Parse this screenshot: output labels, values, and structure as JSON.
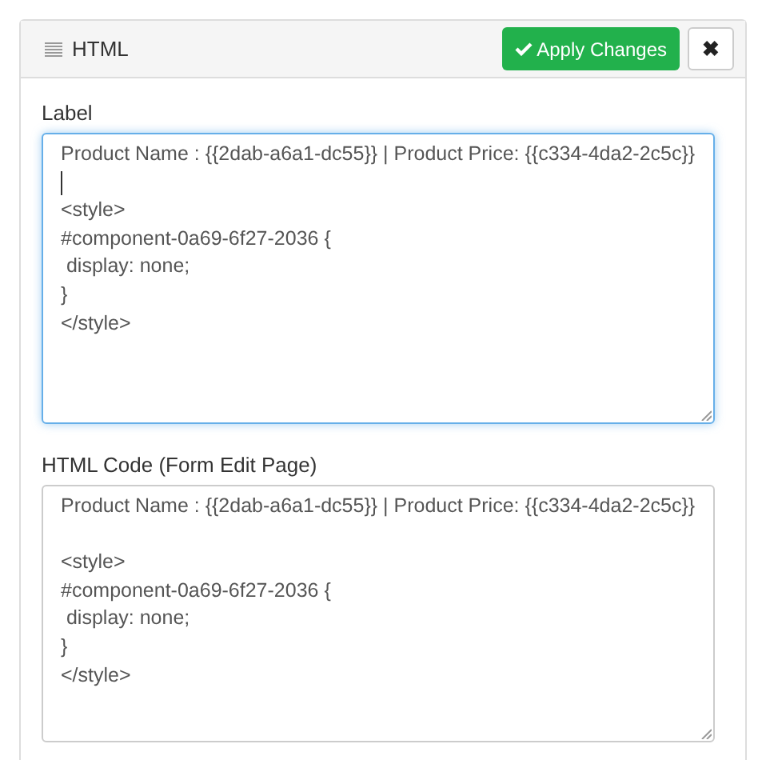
{
  "panel": {
    "title": "HTML",
    "apply_button": "Apply Changes",
    "close_button": "✖"
  },
  "fields": [
    {
      "label": "Label",
      "value": "Product Name : {{2dab-a6a1-dc55}} | Product Price: {{c334-4da2-2c5c}}\n\n<style>\n#component-0a69-6f27-2036 {\n display: none;\n}\n</style>",
      "focused": true
    },
    {
      "label": "HTML Code (Form Edit Page)",
      "value": "Product Name : {{2dab-a6a1-dc55}} | Product Price: {{c334-4da2-2c5c}}\n\n<style>\n#component-0a69-6f27-2036 {\n display: none;\n}\n</style>",
      "focused": false
    }
  ]
}
